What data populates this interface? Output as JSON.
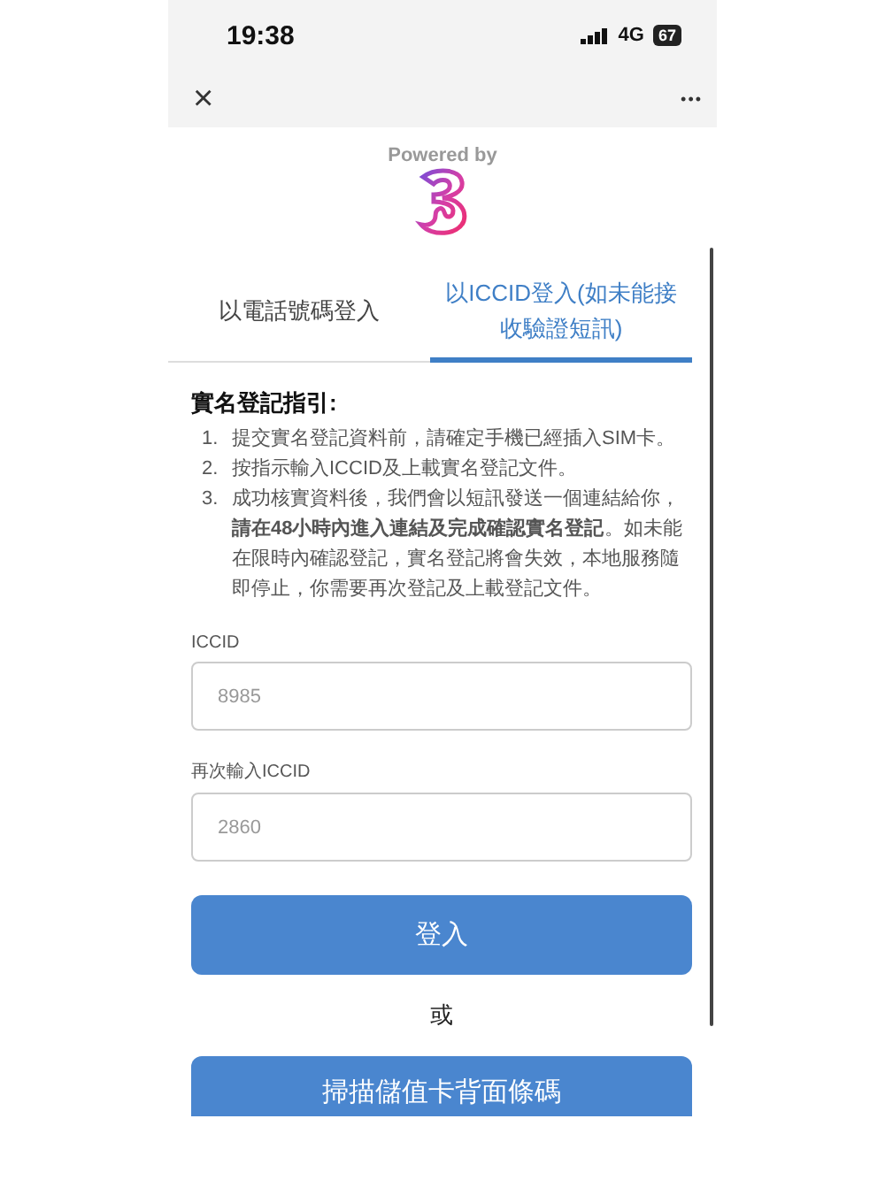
{
  "status_bar": {
    "time": "19:38",
    "network": "4G",
    "battery": "67"
  },
  "nav": {
    "close": "×",
    "more": "•••"
  },
  "brand": {
    "powered_by": "Powered by"
  },
  "tabs": [
    {
      "label": "以電話號碼登入",
      "selected": false
    },
    {
      "label": "以ICCID登入(如未能接收驗證短訊)",
      "selected": true
    }
  ],
  "guide": {
    "title": "實名登記指引:",
    "items": [
      {
        "number": "1.",
        "text": "提交實名登記資料前，請確定手機已經插入SIM卡。"
      },
      {
        "number": "2.",
        "text": "按指示輸入ICCID及上載實名登記文件。"
      },
      {
        "number": "3.",
        "text": "成功核實資料後，我們會以短訊發送一個連結給你，**請在48小時內進入連結及完成確認實名登記**。如未能在限時內確認登記，實名登記將會失效，本地服務隨即停止，你需要再次登記及上載登記文件。"
      }
    ]
  },
  "fields": [
    {
      "label": "ICCID",
      "value": "8985"
    },
    {
      "label": "再次輸入ICCID",
      "value": "2860"
    }
  ],
  "login_button": "登入",
  "separator": "或",
  "scan_button": "掃描儲值卡背面條碼"
}
